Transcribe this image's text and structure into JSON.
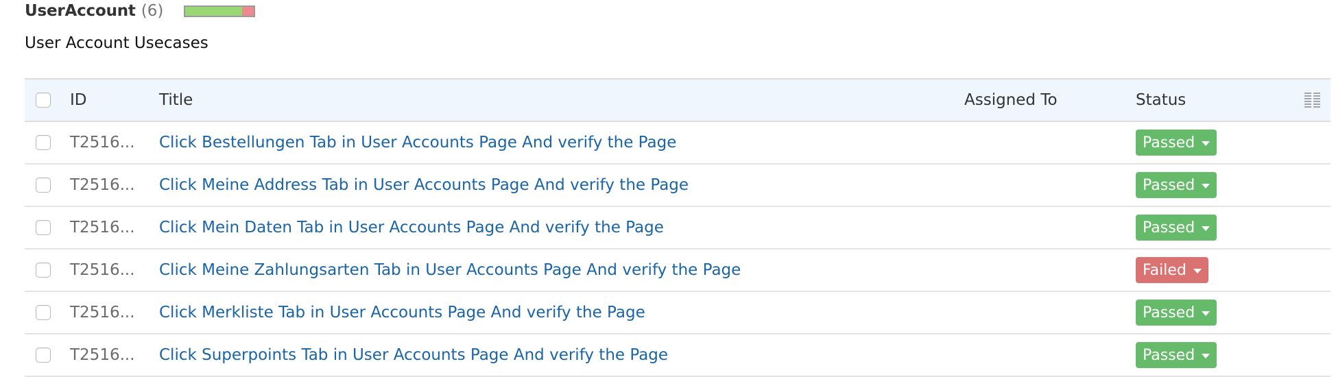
{
  "section": {
    "title": "UserAccount",
    "count": "(6)",
    "progress": {
      "passed_fraction": 0.8333,
      "failed_fraction": 0.1667,
      "passed_color": "#98d774",
      "failed_color": "#ee8a8f"
    },
    "description": "User Account Usecases"
  },
  "table": {
    "columns": {
      "id": "ID",
      "title": "Title",
      "assigned_to": "Assigned To",
      "status": "Status",
      "column_chooser_icon": "columns-icon"
    },
    "status_colors": {
      "Passed": "#66bb6a",
      "Failed": "#db7272"
    },
    "rows": [
      {
        "id": "T2516...",
        "title": "Click Bestellungen Tab in User Accounts Page And verify the Page",
        "assigned_to": "",
        "status": "Passed"
      },
      {
        "id": "T2516...",
        "title": "Click Meine Address Tab in User Accounts Page And verify the Page",
        "assigned_to": "",
        "status": "Passed"
      },
      {
        "id": "T2516...",
        "title": "Click Mein Daten Tab in User Accounts Page And verify the Page",
        "assigned_to": "",
        "status": "Passed"
      },
      {
        "id": "T2516...",
        "title": "Click Meine Zahlungsarten Tab in User Accounts Page And verify the Page",
        "assigned_to": "",
        "status": "Failed"
      },
      {
        "id": "T2516...",
        "title": "Click Merkliste Tab in User Accounts Page And verify the Page",
        "assigned_to": "",
        "status": "Passed"
      },
      {
        "id": "T2516...",
        "title": "Click Superpoints Tab in User Accounts Page And verify the Page",
        "assigned_to": "",
        "status": "Passed"
      }
    ]
  }
}
